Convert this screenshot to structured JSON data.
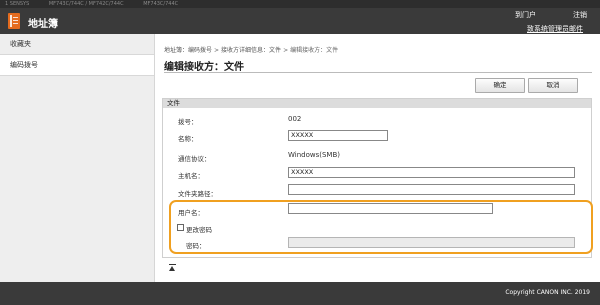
{
  "topbar": {
    "crumbs": [
      "1 SENSYS",
      "MF743C/744C / MF742C/744C",
      "MF743C/744C"
    ]
  },
  "header": {
    "title": "地址簿",
    "portal_link": "到门户",
    "logout_link": "注销",
    "admin_link": "致系统管理员邮件",
    "logo_icon": "address-book-icon",
    "accent_color": "#e46b1e"
  },
  "sidebar": {
    "items": [
      {
        "label": "收藏夹"
      },
      {
        "label": "编码拨号"
      }
    ]
  },
  "main": {
    "breadcrumb": [
      "地址簿：编码拨号",
      "接收方详细信息：文件",
      "编辑接收方：文件"
    ],
    "page_title": "编辑接收方：文件",
    "ok_label": "确定",
    "cancel_label": "取消",
    "section_title": "文件",
    "fields": {
      "number_label": "拨号：",
      "number_value": "002",
      "name_label": "名称：",
      "name_value": "XXXXX",
      "protocol_label": "通信协议：",
      "protocol_value": "Windows(SMB)",
      "host_label": "主机名：",
      "host_value": "XXXXX",
      "folder_label": "文件夹路径：",
      "folder_value": "",
      "user_label": "用户名：",
      "user_value": "",
      "change_password_label": "更改密码",
      "password_label": "密码：",
      "password_value": ""
    },
    "highlight_color": "#f0a020"
  },
  "footer": {
    "copyright": "Copyright CANON INC. 2019"
  }
}
